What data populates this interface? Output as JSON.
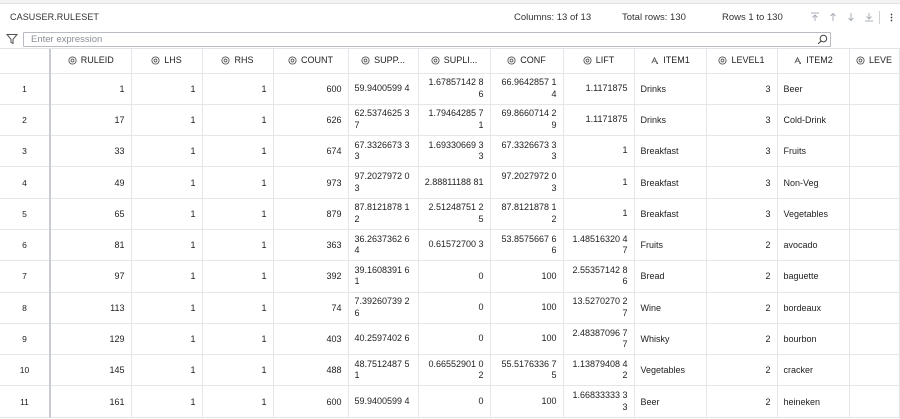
{
  "header": {
    "title": "CASUSER.RULESET",
    "columns_info": "Columns: 13 of 13",
    "total_rows": "Total rows: 130",
    "rows_range": "Rows 1 to 130"
  },
  "filter": {
    "placeholder": "Enter expression"
  },
  "columns": [
    {
      "label": "RULEID",
      "icon": "numeric-column-icon"
    },
    {
      "label": "LHS",
      "icon": "numeric-column-icon"
    },
    {
      "label": "RHS",
      "icon": "numeric-column-icon"
    },
    {
      "label": "COUNT",
      "icon": "numeric-column-icon"
    },
    {
      "label": "SUPP...",
      "icon": "numeric-column-icon"
    },
    {
      "label": "SUPLI...",
      "icon": "numeric-column-icon"
    },
    {
      "label": "CONF",
      "icon": "numeric-column-icon"
    },
    {
      "label": "LIFT",
      "icon": "numeric-column-icon"
    },
    {
      "label": "ITEM1",
      "icon": "character-column-icon"
    },
    {
      "label": "LEVEL1",
      "icon": "numeric-column-icon"
    },
    {
      "label": "ITEM2",
      "icon": "character-column-icon"
    },
    {
      "label": "LEVE",
      "icon": "numeric-column-icon"
    }
  ],
  "rows": [
    {
      "n": "1",
      "ruleid": "1",
      "lhs": "1",
      "rhs": "1",
      "count": "600",
      "supp": "59.9400599 4",
      "supli": "1.67857142 86",
      "conf": "66.9642857 14",
      "lift": "1.1171875",
      "item1": "Drinks",
      "level1": "3",
      "item2": "Beer"
    },
    {
      "n": "2",
      "ruleid": "17",
      "lhs": "1",
      "rhs": "1",
      "count": "626",
      "supp": "62.5374625 37",
      "supli": "1.79464285 71",
      "conf": "69.8660714 29",
      "lift": "1.1171875",
      "item1": "Drinks",
      "level1": "3",
      "item2": "Cold-Drink"
    },
    {
      "n": "3",
      "ruleid": "33",
      "lhs": "1",
      "rhs": "1",
      "count": "674",
      "supp": "67.3326673 33",
      "supli": "1.69330669 33",
      "conf": "67.3326673 33",
      "lift": "1",
      "item1": "Breakfast",
      "level1": "3",
      "item2": "Fruits"
    },
    {
      "n": "4",
      "ruleid": "49",
      "lhs": "1",
      "rhs": "1",
      "count": "973",
      "supp": "97.2027972 03",
      "supli": "2.88811188 81",
      "conf": "97.2027972 03",
      "lift": "1",
      "item1": "Breakfast",
      "level1": "3",
      "item2": "Non-Veg"
    },
    {
      "n": "5",
      "ruleid": "65",
      "lhs": "1",
      "rhs": "1",
      "count": "879",
      "supp": "87.8121878 12",
      "supli": "2.51248751 25",
      "conf": "87.8121878 12",
      "lift": "1",
      "item1": "Breakfast",
      "level1": "3",
      "item2": "Vegetables"
    },
    {
      "n": "6",
      "ruleid": "81",
      "lhs": "1",
      "rhs": "1",
      "count": "363",
      "supp": "36.2637362 64",
      "supli": "0.61572700 3",
      "conf": "53.8575667 66",
      "lift": "1.48516320 47",
      "item1": "Fruits",
      "level1": "2",
      "item2": "avocado"
    },
    {
      "n": "7",
      "ruleid": "97",
      "lhs": "1",
      "rhs": "1",
      "count": "392",
      "supp": "39.1608391 61",
      "supli": "0",
      "conf": "100",
      "lift": "2.55357142 86",
      "item1": "Bread",
      "level1": "2",
      "item2": "baguette"
    },
    {
      "n": "8",
      "ruleid": "113",
      "lhs": "1",
      "rhs": "1",
      "count": "74",
      "supp": "7.39260739 26",
      "supli": "0",
      "conf": "100",
      "lift": "13.5270270 27",
      "item1": "Wine",
      "level1": "2",
      "item2": "bordeaux"
    },
    {
      "n": "9",
      "ruleid": "129",
      "lhs": "1",
      "rhs": "1",
      "count": "403",
      "supp": "40.2597402 6",
      "supli": "0",
      "conf": "100",
      "lift": "2.48387096 77",
      "item1": "Whisky",
      "level1": "2",
      "item2": "bourbon"
    },
    {
      "n": "10",
      "ruleid": "145",
      "lhs": "1",
      "rhs": "1",
      "count": "488",
      "supp": "48.7512487 51",
      "supli": "0.66552901 02",
      "conf": "55.5176336 75",
      "lift": "1.13879408 42",
      "item1": "Vegetables",
      "level1": "2",
      "item2": "cracker"
    },
    {
      "n": "11",
      "ruleid": "161",
      "lhs": "1",
      "rhs": "1",
      "count": "600",
      "supp": "59.9400599 4",
      "supli": "0",
      "conf": "100",
      "lift": "1.66833333 33",
      "item1": "Beer",
      "level1": "2",
      "item2": "heineken"
    }
  ],
  "colors": {
    "accent": "#6b7a8f",
    "grid_line": "#e4e6ea",
    "nav_disabled": "#aab0b8"
  }
}
